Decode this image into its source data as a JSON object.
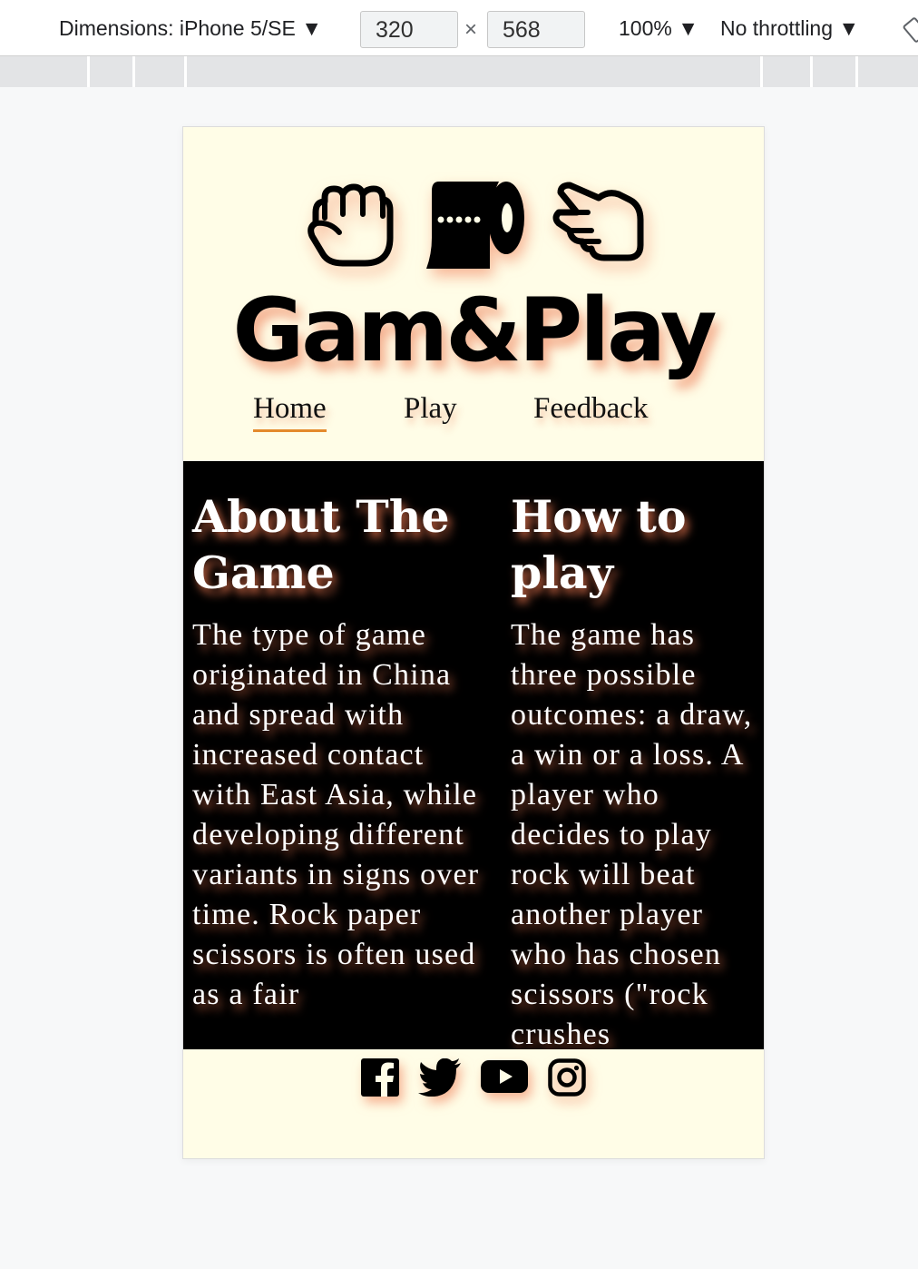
{
  "devtools": {
    "device_label": "Dimensions: iPhone 5/SE ▼",
    "width": "320",
    "times": "×",
    "height": "568",
    "zoom": "100% ▼",
    "throttling": "No throttling ▼"
  },
  "site": {
    "logo": "Gam&Play",
    "nav": {
      "home": "Home",
      "play": "Play",
      "feedback": "Feedback"
    },
    "about": {
      "heading": "About The Game",
      "text": "The type of game originated in China and spread with increased contact with East Asia, while developing different variants in signs over time. Rock paper scissors is often used as a fair"
    },
    "howto": {
      "heading": "How to play",
      "text": "The game has three possible outcomes: a draw, a win or a loss. A player who decides to play rock will beat another player who has chosen scissors (\"rock crushes"
    },
    "icons": [
      "rock-hand-icon",
      "paper-roll-icon",
      "scissors-hand-icon"
    ],
    "social": [
      "facebook-icon",
      "twitter-icon",
      "youtube-icon",
      "instagram-icon"
    ],
    "colors": {
      "background": "#fffde7",
      "main_background": "#000000",
      "glow": "#f07850",
      "nav_underline": "#e48a2c"
    }
  }
}
